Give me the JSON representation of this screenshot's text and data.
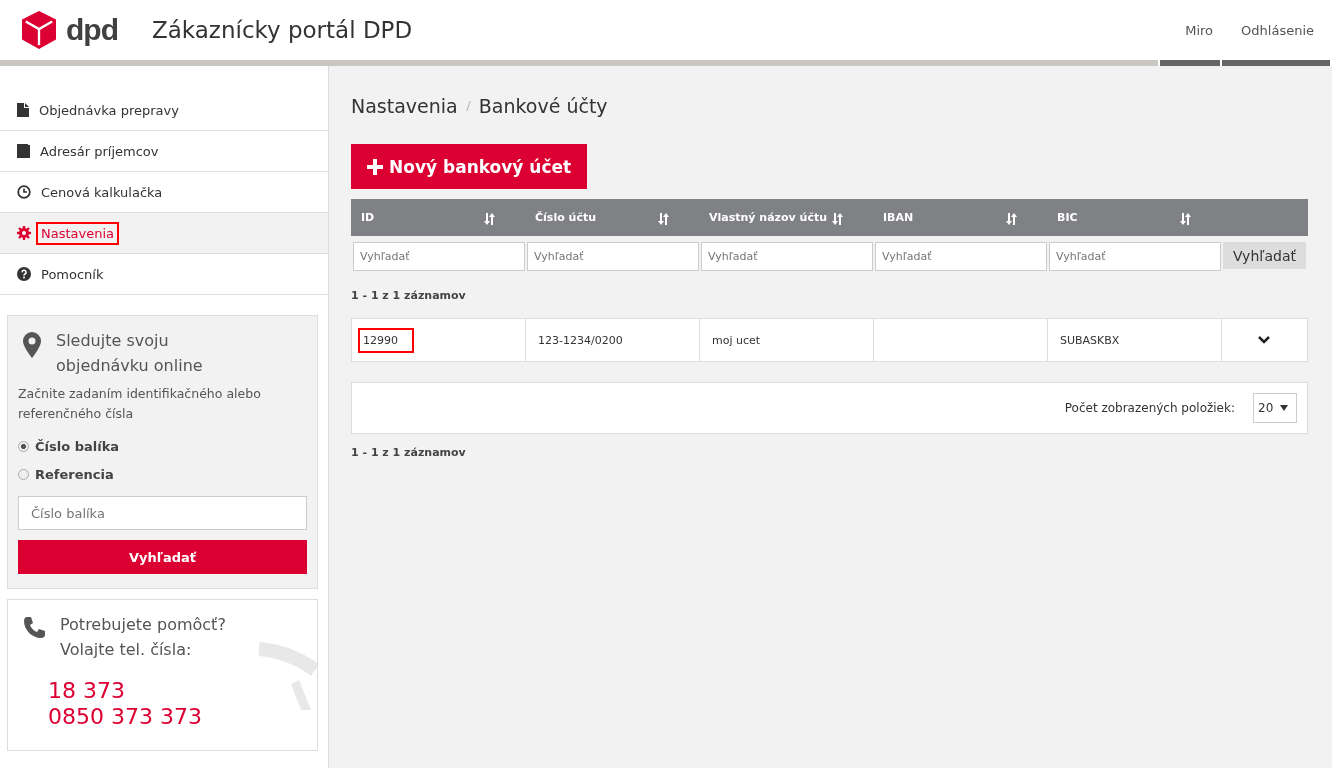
{
  "header": {
    "logo": "dpd",
    "title": "Zákaznícky portál DPD",
    "user": "Miro",
    "logout": "Odhlásenie"
  },
  "sidebar": {
    "items": [
      {
        "label": "Objednávka prepravy",
        "kind": "document",
        "selected": false,
        "highlighted": false
      },
      {
        "label": "Adresár príjemcov",
        "kind": "book",
        "selected": false,
        "highlighted": false
      },
      {
        "label": "Cenová kalkulačka",
        "kind": "clock",
        "selected": false,
        "highlighted": false
      },
      {
        "label": "Nastavenia",
        "kind": "gear",
        "selected": true,
        "highlighted": true
      },
      {
        "label": "Pomocník",
        "kind": "help",
        "selected": false,
        "highlighted": false
      }
    ],
    "tracking": {
      "title": "Sledujte svoju objednávku online",
      "text": "Začnite zadaním identifikačného alebo referenčného čísla",
      "options": [
        {
          "label": "Číslo balíka",
          "selected": true
        },
        {
          "label": "Referencia",
          "selected": false
        }
      ],
      "placeholder": "Číslo balíka",
      "button": "Vyhľadať"
    },
    "help": {
      "title": "Potrebujete pomôcť? Volajte tel. čísla:",
      "phones": [
        "18 373",
        "0850 373 373"
      ]
    }
  },
  "breadcrumb": [
    "Nastavenia",
    "Bankové účty"
  ],
  "new_button": "Nový bankový účet",
  "table": {
    "columns": [
      "ID",
      "Číslo účtu",
      "Vlastný názov účtu",
      "IBAN",
      "BIC"
    ],
    "filter_placeholders": [
      "Vyhľadať",
      "Vyhľadať",
      "Vyhľadať",
      "Vyhľadať",
      "Vyhľadať"
    ],
    "filter_button": "Vyhľadať",
    "count_top": "1 - 1 z 1 záznamov",
    "rows": [
      {
        "cells": [
          "12990",
          "123-1234/0200",
          "moj ucet",
          "",
          "SUBASKBX"
        ],
        "highlighted": true
      }
    ],
    "page_size_label": "Počet zobrazených položiek:",
    "page_size": "20",
    "count_bottom": "1 - 1 z 1 záznamov"
  }
}
